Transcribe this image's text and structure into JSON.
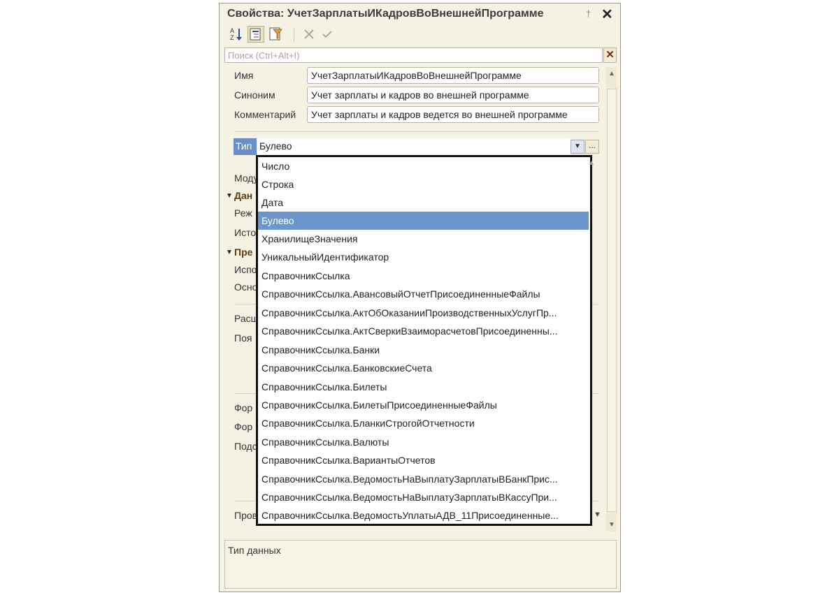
{
  "window": {
    "title": "Свойства: УчетЗарплатыИКадровВоВнешнейПрограмме"
  },
  "toolbar": {
    "buttons": [
      {
        "icon": "sort-az-icon"
      },
      {
        "icon": "categories-icon"
      },
      {
        "icon": "filter-icon"
      },
      {
        "icon": "cancel-icon"
      },
      {
        "icon": "confirm-icon"
      }
    ]
  },
  "search": {
    "placeholder": "Поиск (Ctrl+Alt+I)"
  },
  "properties": {
    "name_label": "Имя",
    "name_value": "УчетЗарплатыИКадровВоВнешнейПрограмме",
    "synonym_label": "Синоним",
    "synonym_value": "Учет зарплаты и кадров во внешней программе",
    "comment_label": "Комментарий",
    "comment_value": "Учет зарплаты и кадров ведется во внешней программе",
    "type_label": "Тип",
    "type_value": "Булево"
  },
  "hidden_rows": [
    "Моду",
    "Дан",
    "Реж",
    "Исто",
    "Пре",
    "Испо",
    "Осно",
    "Расш",
    "Поя",
    "Фор",
    "Фор",
    "Подс",
    "Пров"
  ],
  "dropdown": {
    "selected_index": 3,
    "items": [
      "Число",
      "Строка",
      "Дата",
      "Булево",
      "ХранилищеЗначения",
      "УникальныйИдентификатор",
      "СправочникСсылка",
      "СправочникСсылка.АвансовыйОтчетПрисоединенныеФайлы",
      "СправочникСсылка.АктОбОказанииПроизводственныхУслугПр...",
      "СправочникСсылка.АктСверкиВзаиморасчетовПрисоединенны...",
      "СправочникСсылка.Банки",
      "СправочникСсылка.БанковскиеСчета",
      "СправочникСсылка.Билеты",
      "СправочникСсылка.БилетыПрисоединенныеФайлы",
      "СправочникСсылка.БланкиСтрогойОтчетности",
      "СправочникСсылка.Валюты",
      "СправочникСсылка.ВариантыОтчетов",
      "СправочникСсылка.ВедомостьНаВыплатуЗарплатыВБанкПрис...",
      "СправочникСсылка.ВедомостьНаВыплатуЗарплатыВКассуПри...",
      "СправочникСсылка.ВедомостьУплатыАДВ_11Присоединенные..."
    ]
  },
  "description": {
    "text": "Тип данных"
  },
  "colors": {
    "panel_bg": "#f5f2e4",
    "selection": "#6b97cd"
  }
}
